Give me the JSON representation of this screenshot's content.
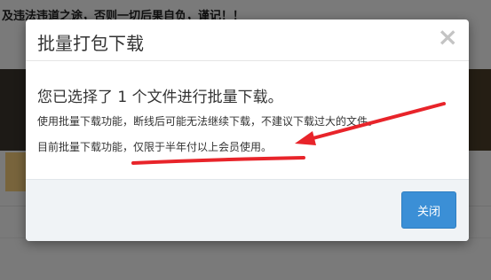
{
  "background": {
    "warning_text": "及违法违道之途，否则一切后果自负，谨记！！"
  },
  "modal": {
    "title": "批量打包下载",
    "close_symbol": "×",
    "message_main": "您已选择了 1 个文件进行批量下载。",
    "message_line1": "使用批量下载功能，断线后可能无法继续下载，不建议下载过大的文件。",
    "message_line2": "目前批量下载功能，仅限于半年付以上会员使用。",
    "close_button_label": "关闭"
  },
  "colors": {
    "primary_button": "#3b8fd6",
    "annotation_red": "#e8242a",
    "backdrop": "rgba(0,0,0,0.5)"
  }
}
